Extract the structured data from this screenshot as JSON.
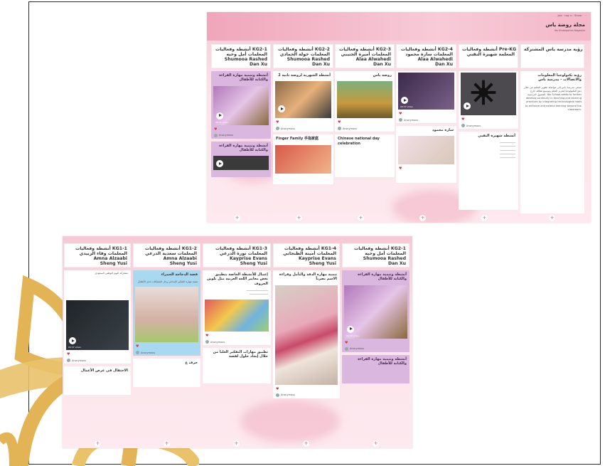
{
  "colors": {
    "gold": "#e2b455",
    "pink": "#f5c9d5",
    "purple_card": "#d9b7df",
    "blue_card": "#a9d9f0",
    "heart": "#d03a4c"
  },
  "top_board": {
    "topbar": "Join  ·  Log in  ·  Share  ·  ⋯",
    "title": "مجلة روضة ياس",
    "subtitle": "Yas Kindergarten Magazine",
    "columns": [
      {
        "l1": "رؤية مدرسة ياس المشتركة",
        "l2": "",
        "l3": "",
        "l4": ""
      },
      {
        "l1": "أنشطة وفعاليات Pre-KG",
        "l2": "المعلمة شهيرة النقبي",
        "l3": "",
        "l4": ""
      },
      {
        "l1": "أنشطة وفعاليات KG2-4",
        "l2": "المعلمات سارة محمود",
        "l3": "Alaa Alwahedi",
        "l4": "Dan Xu"
      },
      {
        "l1": "أنشطة وفعاليات KG2-3",
        "l2": "المعلمات أميرة الجنيبي",
        "l3": "Alaa Alwahedi",
        "l4": "Dan Xu"
      },
      {
        "l1": "أنشطة وفعاليات KG2-2",
        "l2": "المعلمات خولة الحمادي",
        "l3": "Shumooa Rashed",
        "l4": "Dan Xu"
      },
      {
        "l1": "أنشطة وفعاليات KG2-1",
        "l2": "المعلمات أمل وحيه",
        "l3": "Shumooa Rashed",
        "l4": "Dan Xu"
      }
    ],
    "cards": {
      "vision_title": "رؤية تكنولوجيا المعلومات والاتصالات - مدرسة ياس",
      "vision_text": "تسعى مدرسة ياس إلى مواصلة تطوير التعليم من خلال دمج التكنولوجيا لتعزيز التعلم وتوسيع نطاقه خارج الفصول الدراسية. Yas School seeks to further develop continuity in teaching and learning practices by integrating technological tools to enhance and extend learning beyond the classroom.",
      "prekg_section": "أنشطة شهيرة النقبي",
      "kg24_card": "سارة محمود",
      "kg23_card": "روضة ياس",
      "kg23_chinese": "Chinese national day celebration",
      "kg22_card": "أنشطة الشهرية لروضة ثانية 2",
      "kg22_finger": "Finger Family 手指家庭",
      "kg21_card": "أنشطة وتنمية مهارة القراءة والكتابة للأطفال",
      "kg21_card2": "أنشطة وتنمية مهارة القراءة والكتابة للأطفال",
      "anon": "Anonymous",
      "comment": "1 comment",
      "video": "00:37 video"
    }
  },
  "bottom_board": {
    "columns": [
      {
        "l1": "أنشطة وفعاليات KG1-1",
        "l2": "المعلمات وفاء الزبيدي",
        "l3": "Amna Alzaabi",
        "l4": "Sheng Yusi"
      },
      {
        "l1": "أنشطة وفعاليات KG1-2",
        "l2": "المعلمات سعدية الدرعي",
        "l3": "Amna Alzaabi",
        "l4": "Sheng Yusi"
      },
      {
        "l1": "أنشطة وفعاليات KG1-3",
        "l2": "المعلمات نورة الدرعي",
        "l3": "Kayprise Evans",
        "l4": "Sheng Yusi"
      },
      {
        "l1": "أنشطة وفعاليات KG1-4",
        "l2": "المعلمات أمينة الظنحاني",
        "l3": "Kayprise Evans",
        "l4": "Sheng Yusi"
      },
      {
        "l1": "أنشطة وفعاليات KG2-1",
        "l2": "المعلمات أمل وحيه",
        "l3": "Shumooa Rashed",
        "l4": "Dan Xu"
      }
    ],
    "cards": {
      "kg11_title": "مشاركة اليوم الوطني السعودي",
      "kg11_bottom": "الاحتفال في عرض الأعمال",
      "kg12_title": "قصة الدجاجة الحمراء",
      "kg12_text": "تنمية مهارة التفكير الإبداعي وحل المشكلات لدى الأطفال",
      "kg12_bottom": "حرف ع",
      "kg13_title": "إعمال للأنشطة الخاصة بتطبيق بعض معايير اللغة العربية مثل تلوين الحروف",
      "kg13_bottom": "تطبيق مهارات التفكير العليا من خلال إيجاد حلول لقصة",
      "kg14_title": "تنمية مهارة الدقة والتأمل وقراءة الاسم بصرياً",
      "kg21_title": "أنشطة وتنمية مهارة القراءة والكتابة للأطفال",
      "kg21_bottom": "أنشطة وتنمية مهارة القراءة والكتابة للأطفال",
      "anon": "Anonymous",
      "comment": "1 comment",
      "video": "00:37 video"
    }
  }
}
